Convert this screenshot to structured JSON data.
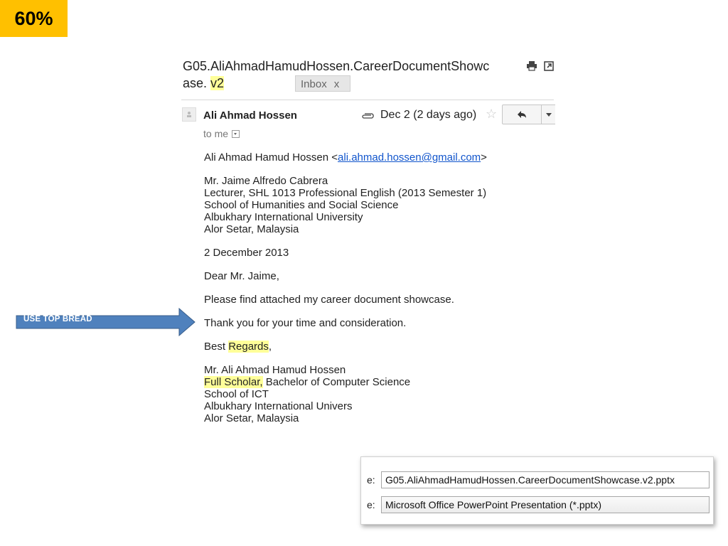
{
  "badge": "60%",
  "subject": {
    "text": "G05.AliAhmadHamudHossen.CareerDocumentShowcase. ",
    "highlight": "v2",
    "label": "Inbox",
    "label_close": "x"
  },
  "message": {
    "sender": "Ali Ahmad Hossen",
    "date": "Dec 2 (2 days ago)",
    "to": "to me",
    "from_line_prefix": "Ali Ahmad Hamud Hossen <",
    "from_email": "ali.ahmad.hossen@gmail.com",
    "from_line_suffix": ">",
    "recipient": [
      "Mr. Jaime Alfredo Cabrera",
      "Lecturer, SHL 1013 Professional English (2013 Semester 1)",
      "School of Humanities and Social Science",
      "Albukhary International University",
      "Alor Setar, Malaysia"
    ],
    "date_line": "2 December 2013",
    "salutation": "Dear Mr. Jaime,",
    "body_1": "Please find attached my career document showcase.",
    "body_2": "Thank you for your time and consideration.",
    "closing_prefix": "Best ",
    "closing_highlight": "Regards",
    "closing_suffix": ",",
    "sig_name": "Mr. Ali Ahmad Hamud Hossen",
    "sig_title_highlight": "Full Scholar,",
    "sig_title_rest": " Bachelor of Computer Science",
    "sig_school": "School of ICT",
    "sig_university": "Albukhary International Univers",
    "sig_location": "Alor Setar, Malaysia"
  },
  "annotation": {
    "arrow_text": "USE TOP BREAD",
    "arrow_color": "#4f81bd"
  },
  "save_dialog": {
    "filename_label": "e:",
    "filename": "G05.AliAhmadHamudHossen.CareerDocumentShowcase.v2.pptx",
    "type_label": "e:",
    "type": "Microsoft Office PowerPoint Presentation (*.pptx)"
  },
  "colors": {
    "badge_bg": "#ffc000",
    "highlight": "#ffff99",
    "link": "#1155cc"
  }
}
